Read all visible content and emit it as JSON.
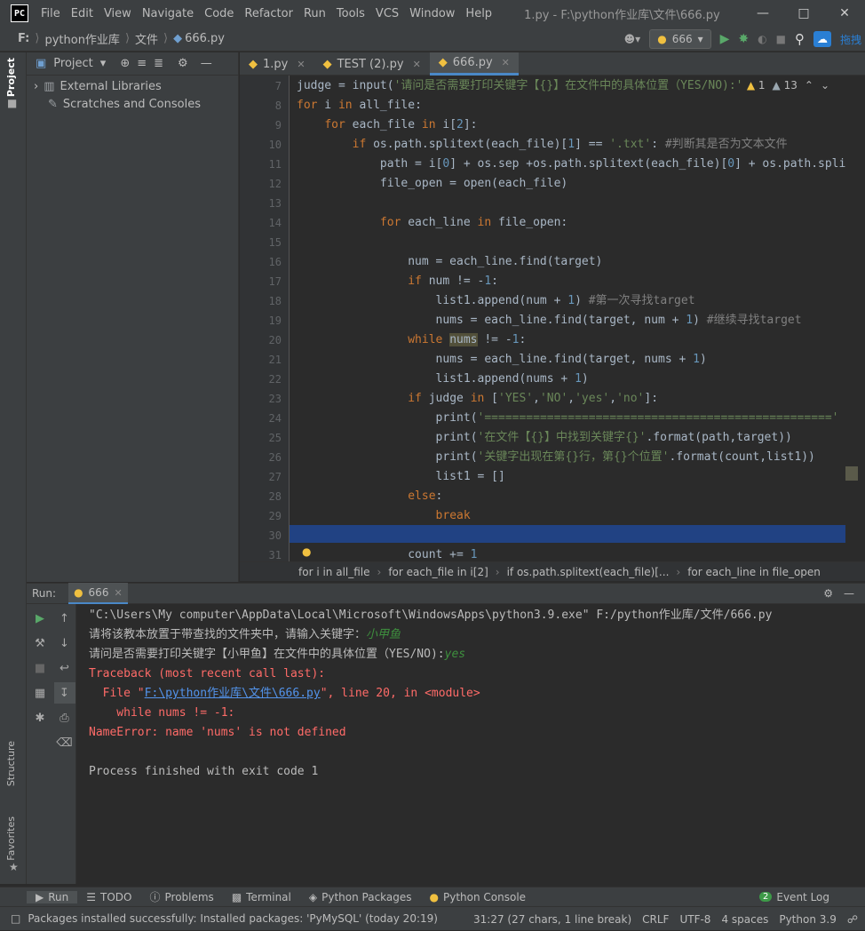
{
  "window": {
    "logo": "PC",
    "title": "1.py - F:\\python作业库\\文件\\666.py",
    "menu": [
      "File",
      "Edit",
      "View",
      "Navigate",
      "Code",
      "Refactor",
      "Run",
      "Tools",
      "VCS",
      "Window",
      "Help"
    ]
  },
  "navbar": {
    "crumbs": [
      "F:",
      "python作业库",
      "文件",
      "666.py"
    ],
    "run_config": "666",
    "extra_label": "拖拽"
  },
  "project": {
    "header": "Project",
    "items": [
      "External Libraries",
      "Scratches and Consoles"
    ]
  },
  "side_tabs": {
    "project": "Project",
    "structure": "Structure",
    "favorites": "Favorites"
  },
  "tabs": [
    {
      "label": "1.py",
      "active": false
    },
    {
      "label": "TEST (2).py",
      "active": false
    },
    {
      "label": "666.py",
      "active": true
    }
  ],
  "inspections": {
    "warnings": "1",
    "weak_warnings": "13"
  },
  "editor": {
    "lines": [
      {
        "n": "7",
        "html": "judge = <span class='fn'>input</span>(<span class='str'>'请问是否需要打印关键字【{}】在文件中的具体位置（YES/NO):'</span>.'"
      },
      {
        "n": "8",
        "html": "<span class='kw'>for</span> i <span class='kw'>in</span> all_file:"
      },
      {
        "n": "9",
        "html": "    <span class='kw'>for</span> each_file <span class='kw'>in</span> i[<span class='num'>2</span>]:"
      },
      {
        "n": "10",
        "html": "        <span class='kw'>if</span> os.path.splitext(each_file)[<span class='num'>1</span>] == <span class='str'>'.txt'</span>: <span class='cmt'>#判断其是否为文本文件</span>"
      },
      {
        "n": "11",
        "html": "            path = i[<span class='num'>0</span>] + os.sep +os.path.splitext(each_file)[<span class='num'>0</span>] + os.path.spli"
      },
      {
        "n": "12",
        "html": "            file_open = <span class='fn'>open</span>(each_file)"
      },
      {
        "n": "13",
        "html": ""
      },
      {
        "n": "14",
        "html": "            <span class='kw'>for</span> each_line <span class='kw'>in</span> file_open:"
      },
      {
        "n": "15",
        "html": ""
      },
      {
        "n": "16",
        "html": "                num = each_line.find(target)"
      },
      {
        "n": "17",
        "html": "                <span class='kw'>if</span> num != -<span class='num'>1</span>:"
      },
      {
        "n": "18",
        "html": "                    list1.append(num + <span class='num'>1</span>) <span class='cmt'>#第一次寻找target</span>"
      },
      {
        "n": "19",
        "html": "                    nums = each_line.find(target, num + <span class='num'>1</span>) <span class='cmt'>#继续寻找target</span>"
      },
      {
        "n": "20",
        "html": "                <span class='kw'>while</span> <span style='background:#52503a'>nums</span> != -<span class='num'>1</span>:"
      },
      {
        "n": "21",
        "html": "                    nums = each_line.find(target, nums + <span class='num'>1</span>)"
      },
      {
        "n": "22",
        "html": "                    list1.append(nums + <span class='num'>1</span>)"
      },
      {
        "n": "23",
        "html": "                <span class='kw'>if</span> judge <span class='kw'>in</span> [<span class='str'>'YES'</span>,<span class='str'>'NO'</span>,<span class='str'>'yes'</span>,<span class='str'>'no'</span>]:"
      },
      {
        "n": "24",
        "html": "                    <span class='fn'>print</span>(<span class='str'>'=================================================='</span>"
      },
      {
        "n": "25",
        "html": "                    <span class='fn'>print</span>(<span class='str'>'在文件【{}】中找到关键字{}'</span>.format(path,target))"
      },
      {
        "n": "26",
        "html": "                    <span class='fn'>print</span>(<span class='str'>'关键字出现在第{}行，第{}个位置'</span>.format(count,list1))"
      },
      {
        "n": "27",
        "html": "                    list1 = []"
      },
      {
        "n": "28",
        "html": "                <span class='kw'>else</span>:"
      },
      {
        "n": "29",
        "html": "                    <span class='kw'>break</span>"
      },
      {
        "n": "30",
        "html": ""
      },
      {
        "n": "31",
        "html": "                count += <span class='num'>1</span>"
      }
    ]
  },
  "breadcrumbs": [
    "for i in all_file",
    "for each_file in i[2]",
    "if os.path.splitext(each_file)[...",
    "for each_line in file_open"
  ],
  "run": {
    "label": "Run:",
    "config": "666",
    "output": [
      {
        "text": "\"C:\\Users\\My computer\\AppData\\Local\\Microsoft\\WindowsApps\\python3.9.exe\" F:/python作业库/文件/666.py",
        "color": "#bbbbbb"
      },
      {
        "text": "请将该教本放置于带查找的文件夹中，请输入关键字：",
        "color": "#bbbbbb",
        "input": "小甲鱼"
      },
      {
        "text": "请问是否需要打印关键字【小甲鱼】在文件中的具体位置（YES/NO):",
        "color": "#bbbbbb",
        "input": "yes"
      },
      {
        "text": "Traceback (most recent call last):",
        "color": "#ff6b68"
      },
      {
        "text": "  File \"",
        "color": "#ff6b68",
        "link": "F:\\python作业库\\文件\\666.py",
        "after": "\", line 20, in <module>"
      },
      {
        "text": "    while nums != -1:",
        "color": "#ff6b68"
      },
      {
        "text": "NameError: name 'nums' is not defined",
        "color": "#ff6b68"
      },
      {
        "text": "",
        "color": "#bbbbbb"
      },
      {
        "text": "Process finished with exit code 1",
        "color": "#bbbbbb"
      }
    ]
  },
  "bottom_tools": [
    "Run",
    "TODO",
    "Problems",
    "Terminal",
    "Python Packages",
    "Python Console"
  ],
  "event_log": {
    "count": "2",
    "label": "Event Log"
  },
  "status": {
    "message": "Packages installed successfully: Installed packages: 'PyMySQL' (today 20:19)",
    "position": "31:27 (27 chars, 1 line break)",
    "line_sep": "CRLF",
    "encoding": "UTF-8",
    "indent": "4 spaces",
    "interpreter": "Python 3.9"
  }
}
